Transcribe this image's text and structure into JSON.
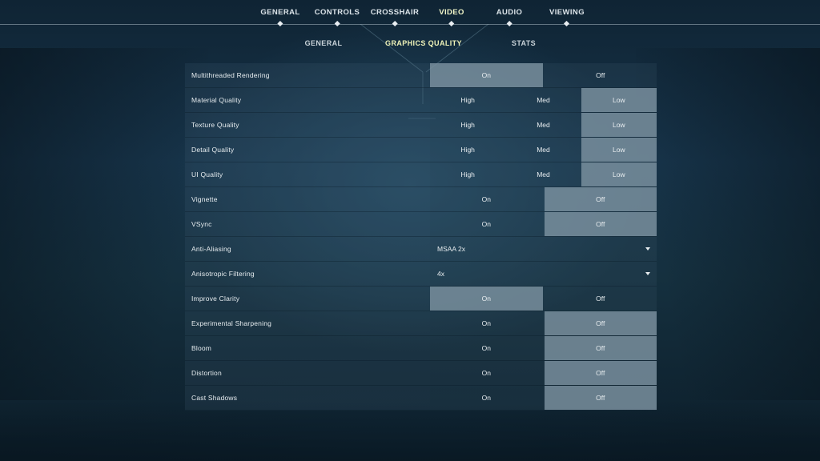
{
  "top_tabs": [
    {
      "label": "GENERAL"
    },
    {
      "label": "CONTROLS"
    },
    {
      "label": "CROSSHAIR"
    },
    {
      "label": "VIDEO"
    },
    {
      "label": "AUDIO"
    },
    {
      "label": "VIEWING"
    }
  ],
  "active_top_tab": "VIDEO",
  "sub_tabs": [
    {
      "label": "GENERAL"
    },
    {
      "label": "GRAPHICS QUALITY"
    },
    {
      "label": "STATS"
    }
  ],
  "active_sub_tab": "GRAPHICS QUALITY",
  "settings": [
    {
      "name": "Multithreaded Rendering",
      "options": [
        "On",
        "Off"
      ],
      "selected": "On"
    },
    {
      "name": "Material Quality",
      "options": [
        "High",
        "Med",
        "Low"
      ],
      "selected": "Low"
    },
    {
      "name": "Texture Quality",
      "options": [
        "High",
        "Med",
        "Low"
      ],
      "selected": "Low"
    },
    {
      "name": "Detail Quality",
      "options": [
        "High",
        "Med",
        "Low"
      ],
      "selected": "Low"
    },
    {
      "name": "UI Quality",
      "options": [
        "High",
        "Med",
        "Low"
      ],
      "selected": "Low"
    },
    {
      "name": "Vignette",
      "options": [
        "On",
        "Off"
      ],
      "selected": "Off"
    },
    {
      "name": "VSync",
      "options": [
        "On",
        "Off"
      ],
      "selected": "Off"
    },
    {
      "name": "Anti-Aliasing",
      "dropdown": "MSAA 2x"
    },
    {
      "name": "Anisotropic Filtering",
      "dropdown": "4x"
    },
    {
      "name": "Improve Clarity",
      "options": [
        "On",
        "Off"
      ],
      "selected": "On"
    },
    {
      "name": "Experimental Sharpening",
      "options": [
        "On",
        "Off"
      ],
      "selected": "Off"
    },
    {
      "name": "Bloom",
      "options": [
        "On",
        "Off"
      ],
      "selected": "Off"
    },
    {
      "name": "Distortion",
      "options": [
        "On",
        "Off"
      ],
      "selected": "Off"
    },
    {
      "name": "Cast Shadows",
      "options": [
        "On",
        "Off"
      ],
      "selected": "Off"
    }
  ],
  "colors": {
    "active_tab_text": "#f1f5c8",
    "selected_option_bg": "#8096a4",
    "background": "#17344a"
  },
  "icons": {
    "dropdown_caret": "caret-down-icon",
    "tab_marker": "diamond-icon"
  }
}
